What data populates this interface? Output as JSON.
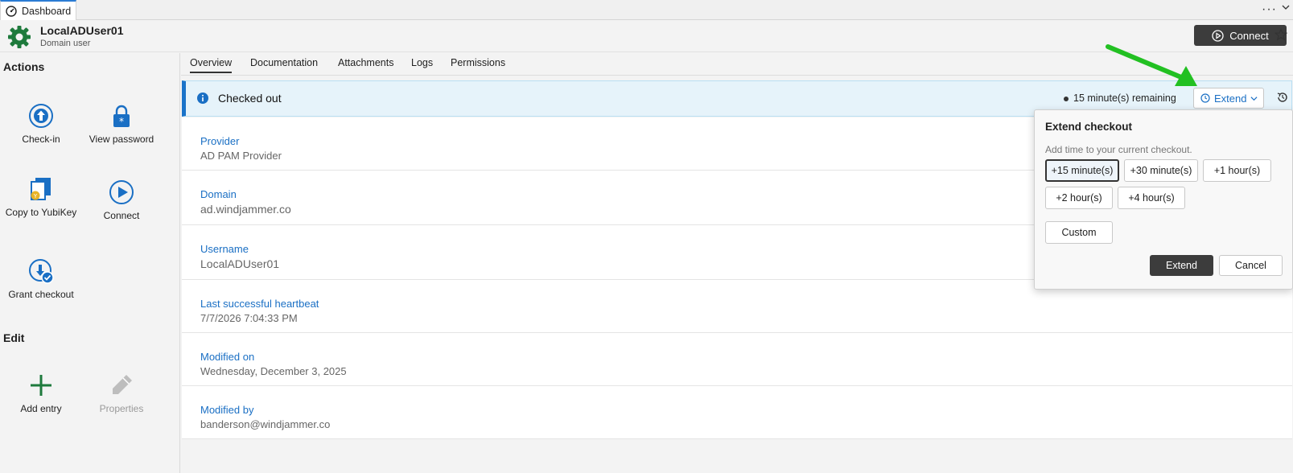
{
  "tab": {
    "label": "Dashboard"
  },
  "header": {
    "name": "LocalADUser01",
    "type": "Domain user",
    "connect_label": "Connect"
  },
  "sidebar": {
    "actions_title": "Actions",
    "edit_title": "Edit",
    "actions": [
      {
        "label": "Check-in"
      },
      {
        "label": "View password"
      },
      {
        "label": "Copy to YubiKey"
      },
      {
        "label": "Connect"
      },
      {
        "label": "Grant checkout"
      }
    ],
    "edit": [
      {
        "label": "Add entry"
      },
      {
        "label": "Properties"
      }
    ]
  },
  "subtabs": [
    "Overview",
    "Documentation",
    "Attachments",
    "Logs",
    "Permissions"
  ],
  "banner": {
    "title": "Checked out",
    "remaining": "15 minute(s) remaining",
    "extend_label": "Extend"
  },
  "fields": [
    {
      "label": "Provider",
      "value": "AD PAM Provider"
    },
    {
      "label": "Domain",
      "value": "ad.windjammer.co"
    },
    {
      "label": "Username",
      "value": "LocalADUser01"
    },
    {
      "label": "Last successful heartbeat",
      "value": "7/7/2026 7:04:33 PM"
    },
    {
      "label": "Modified on",
      "value": "Wednesday, December 3, 2025"
    },
    {
      "label": "Modified by",
      "value": "banderson@windjammer.co"
    }
  ],
  "popup": {
    "title": "Extend checkout",
    "subtitle": "Add time to your current checkout.",
    "options": [
      "+15 minute(s)",
      "+30 minute(s)",
      "+1 hour(s)",
      "+2 hour(s)",
      "+4 hour(s)"
    ],
    "selected_option": "+15 minute(s)",
    "custom_label": "Custom",
    "extend_label": "Extend",
    "cancel_label": "Cancel"
  },
  "colors": {
    "accent": "#1a6fc4",
    "annotation_arrow": "#22c022",
    "entry_icon": "#1e7a3c"
  }
}
